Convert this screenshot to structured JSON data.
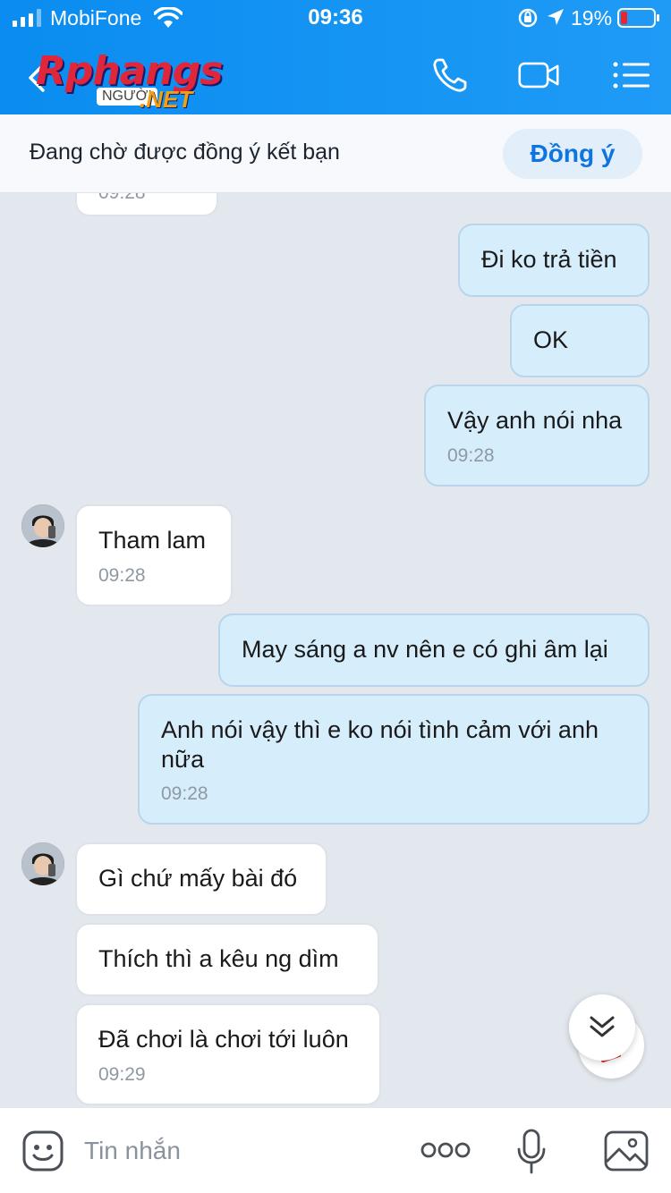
{
  "status": {
    "carrier": "MobiFone",
    "time": "09:36",
    "battery": "19%"
  },
  "header": {
    "logo_main": "Rphangs",
    "logo_sub": "NGƯỜI",
    "logo_net": ".NET"
  },
  "request": {
    "text": "Đang chờ được đồng ý kết bạn",
    "accept_label": "Đồng ý"
  },
  "messages": [
    {
      "dir": "in",
      "text": "",
      "time": "09:28"
    },
    {
      "dir": "out",
      "text": "Đi ko trả tiền",
      "time": ""
    },
    {
      "dir": "out",
      "text": "OK",
      "time": ""
    },
    {
      "dir": "out",
      "text": "Vậy anh nói nha",
      "time": "09:28"
    },
    {
      "dir": "in",
      "text": "Tham lam",
      "time": "09:28"
    },
    {
      "dir": "out",
      "text": "May sáng a nv nên e có ghi âm lại",
      "time": ""
    },
    {
      "dir": "out",
      "text": "Anh nói vậy thì e ko nói tình cảm với anh nữa",
      "time": "09:28"
    },
    {
      "dir": "in",
      "text": "Gì chứ mấy bài đó",
      "time": ""
    },
    {
      "dir": "in",
      "text": "Thích thì a kêu ng dìm",
      "time": ""
    },
    {
      "dir": "in",
      "text": "Đã chơi là chơi tới luôn",
      "time": "09:29"
    }
  ],
  "input": {
    "placeholder": "Tin nhắn"
  },
  "colors": {
    "header": "#0a8cf0",
    "out_bubble": "#d6edfc",
    "in_bubble": "#ffffff",
    "accent": "#0d74e0"
  }
}
